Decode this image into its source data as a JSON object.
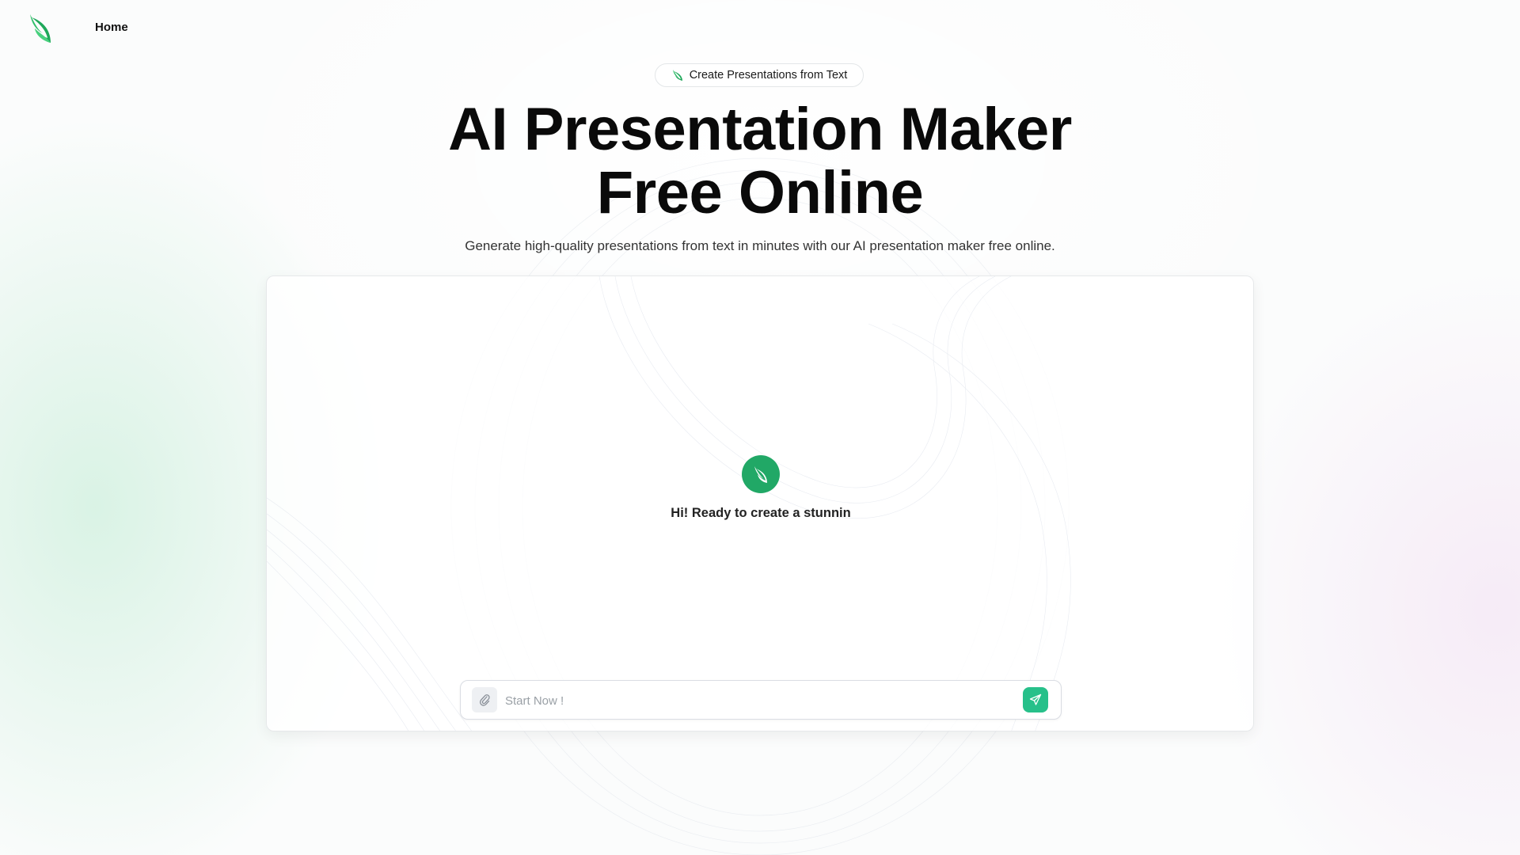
{
  "header": {
    "logo_icon": "leaf-logo-icon",
    "nav": [
      {
        "label": "Home"
      }
    ]
  },
  "hero": {
    "badge_icon": "leaf-icon",
    "badge_text": "Create Presentations from Text",
    "title_line1": "AI Presentation Maker",
    "title_line2": "Free Online",
    "subtitle": "Generate high-quality presentations from text in minutes with our AI presentation maker free online."
  },
  "chat": {
    "avatar_icon": "leaf-avatar-icon",
    "greeting": "Hi! Ready to create a stunnin",
    "input": {
      "value": "",
      "placeholder": "Start Now !"
    },
    "attach_icon": "paperclip-icon",
    "send_icon": "send-icon"
  },
  "colors": {
    "brand_green": "#21a866",
    "send_button": "#27c08a",
    "text_dark": "#0a0a0a"
  }
}
